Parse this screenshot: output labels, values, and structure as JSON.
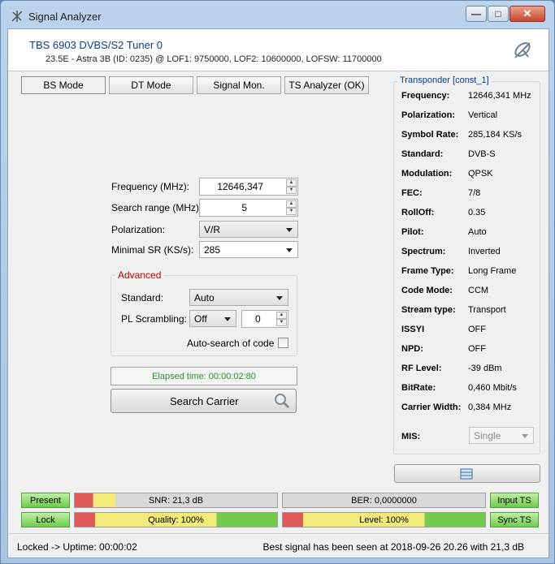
{
  "window": {
    "title": "Signal Analyzer"
  },
  "header": {
    "tuner_name": "TBS 6903 DVBS/S2 Tuner 0",
    "tuner_info": "23.5E - Astra 3B (ID: 0235) @ LOF1: 9750000, LOF2: 10600000, LOFSW: 11700000"
  },
  "tabs": [
    "BS Mode",
    "DT Mode",
    "Signal Mon.",
    "TS Analyzer (OK)"
  ],
  "form": {
    "frequency_label": "Frequency (MHz):",
    "frequency_value": "12646,347",
    "search_range_label": "Search range (MHz):",
    "search_range_value": "5",
    "polarization_label": "Polarization:",
    "polarization_value": "V/R",
    "min_sr_label": "Minimal SR (KS/s):",
    "min_sr_value": "285"
  },
  "advanced": {
    "title": "Advanced",
    "standard_label": "Standard:",
    "standard_value": "Auto",
    "pl_label": "PL Scrambling:",
    "pl_value": "Off",
    "pl_code": "0",
    "auto_search_label": "Auto-search of code"
  },
  "elapsed": "Elapsed time: 00:00:02:80",
  "search_button": "Search Carrier",
  "transponder": {
    "title": "Transponder [const_1]",
    "rows": [
      {
        "k": "Frequency:",
        "v": "12646,341 MHz"
      },
      {
        "k": "Polarization:",
        "v": "Vertical"
      },
      {
        "k": "Symbol Rate:",
        "v": "285,184 KS/s"
      },
      {
        "k": "Standard:",
        "v": "DVB-S"
      },
      {
        "k": "Modulation:",
        "v": "QPSK"
      },
      {
        "k": "FEC:",
        "v": "7/8"
      },
      {
        "k": "RollOff:",
        "v": "0.35"
      },
      {
        "k": "Pilot:",
        "v": "Auto"
      },
      {
        "k": "Spectrum:",
        "v": "Inverted"
      },
      {
        "k": "Frame Type:",
        "v": "Long Frame"
      },
      {
        "k": "Code Mode:",
        "v": "CCM"
      },
      {
        "k": "Stream type:",
        "v": "Transport"
      },
      {
        "k": "ISSYI",
        "v": "OFF"
      },
      {
        "k": "NPD:",
        "v": "OFF"
      },
      {
        "k": "RF Level:",
        "v": "-39 dBm"
      },
      {
        "k": "BitRate:",
        "v": "0,460 Mbit/s"
      },
      {
        "k": "Carrier Width:",
        "v": "0,384 MHz"
      }
    ],
    "mis_label": "MIS:",
    "mis_value": "Single"
  },
  "indicators": {
    "present": "Present",
    "lock": "Lock",
    "input_ts": "Input TS",
    "sync_ts": "Sync TS",
    "snr": "SNR: 21,3 dB",
    "ber": "BER: 0,0000000",
    "quality": "Quality: 100%",
    "level": "Level: 100%"
  },
  "meters": {
    "snr_fill": 0.2,
    "ber_fill": 0.0,
    "quality_fill": 1.0,
    "level_fill": 1.0
  },
  "colors": {
    "green": "#6fcc4c",
    "yellow": "#f3ea7a",
    "red": "#e05a5a",
    "accent": "#0a3c96"
  },
  "status": {
    "left": "Locked -> Uptime: 00:00:02",
    "right": "Best signal has been seen at 2018-09-26 20.26 with 21,3 dB"
  }
}
